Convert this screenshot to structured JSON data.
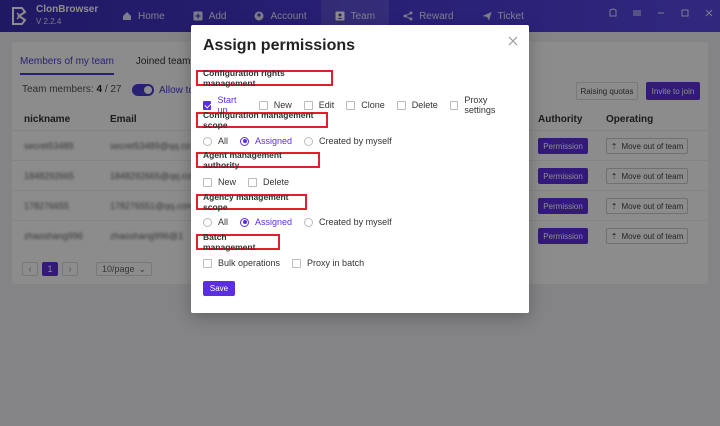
{
  "app": {
    "name": "ClonBrowser",
    "version": "V 2.2.4"
  },
  "nav": [
    {
      "label": "Home",
      "icon": "home-icon"
    },
    {
      "label": "Add",
      "icon": "plus-square-icon"
    },
    {
      "label": "Account",
      "icon": "user-icon"
    },
    {
      "label": "Team",
      "icon": "team-icon"
    },
    {
      "label": "Reward",
      "icon": "share-icon"
    },
    {
      "label": "Ticket",
      "icon": "send-icon"
    }
  ],
  "page": {
    "tabs": [
      "Members of my team",
      "Joined team"
    ],
    "team_members_label": "Team members:",
    "team_members_count": "4",
    "team_members_total": "/ 27",
    "allow_label": "Allow to j",
    "raise_button": "Raising quotas",
    "invite_button": "Invite to join",
    "columns": {
      "nickname": "nickname",
      "email": "Email",
      "authority": "Authority",
      "operating": "Operating"
    },
    "rows": [
      {
        "nickname": "secret53489",
        "email": "secret53489@qq.co",
        "permission": "Permission",
        "move": "Move out of team"
      },
      {
        "nickname": "1848292665",
        "email": "1848292665@qq.com",
        "permission": "Permission",
        "move": "Move out of team"
      },
      {
        "nickname": "178276655",
        "email": "178276551@qq.com",
        "permission": "Permission",
        "move": "Move out of team"
      },
      {
        "nickname": "zhaoshang996",
        "email": "zhaoshang996@1",
        "permission": "Permission",
        "move": "Move out of team"
      }
    ],
    "pagination": {
      "prev": "‹",
      "current": "1",
      "next": "›",
      "page_size": "10/page"
    }
  },
  "modal": {
    "title": "Assign permissions",
    "sections": {
      "config_rights": {
        "title": "Configuration rights management",
        "options": [
          {
            "label": "Start up",
            "checked": true
          },
          {
            "label": "New",
            "checked": false
          },
          {
            "label": "Edit",
            "checked": false
          },
          {
            "label": "Clone",
            "checked": false
          },
          {
            "label": "Delete",
            "checked": false
          },
          {
            "label": "Proxy settings",
            "checked": false
          }
        ]
      },
      "config_scope": {
        "title": "Configuration management scope",
        "options": [
          {
            "label": "All",
            "selected": false
          },
          {
            "label": "Assigned",
            "selected": true
          },
          {
            "label": "Created by myself",
            "selected": false
          }
        ]
      },
      "agent_authority": {
        "title": "Agent management authority",
        "options": [
          {
            "label": "New",
            "checked": false
          },
          {
            "label": "Delete",
            "checked": false
          }
        ]
      },
      "agency_scope": {
        "title": "Agency management scope",
        "options": [
          {
            "label": "All",
            "selected": false
          },
          {
            "label": "Assigned",
            "selected": true
          },
          {
            "label": "Created by myself",
            "selected": false
          }
        ]
      },
      "batch": {
        "title": "Batch management",
        "options": [
          {
            "label": "Bulk operations",
            "checked": false
          },
          {
            "label": "Proxy in batch",
            "checked": false
          }
        ]
      }
    },
    "save_label": "Save"
  },
  "colors": {
    "accent": "#5b2ee0",
    "header": "#4a3bd6",
    "highlight_box": "#e0202a"
  }
}
